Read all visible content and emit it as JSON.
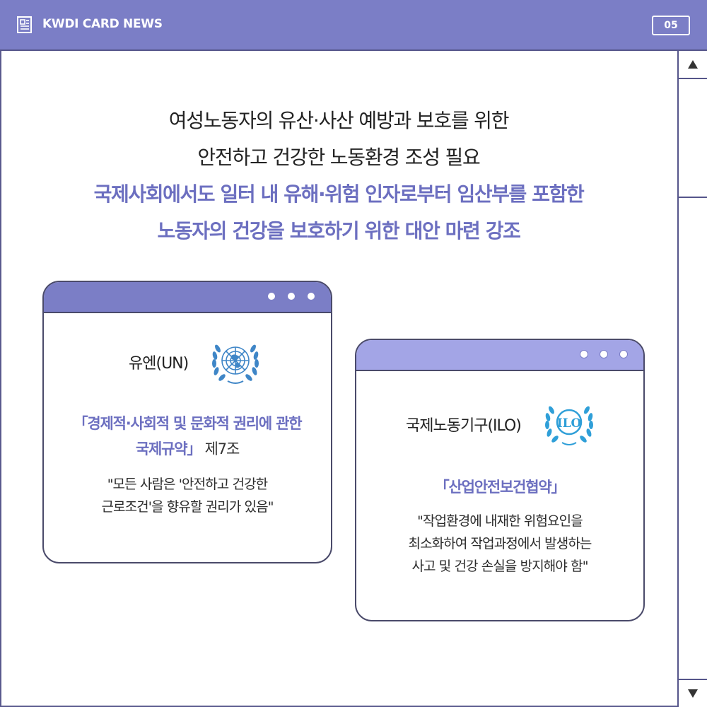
{
  "header": {
    "title": "KWDI CARD NEWS",
    "page_number": "05",
    "icon": "newspaper-icon"
  },
  "headline": {
    "line1": "여성노동자의 유산·사산 예방과 보호를 위한",
    "line2": "안전하고 건강한 노동환경 조성 필요",
    "line3": "국제사회에서도 일터 내 유해·위험 인자로부터 임산부를 포함한",
    "line4": "노동자의 건강을 보호하기 위한 대안 마련 강조"
  },
  "cards": {
    "un": {
      "org_name": "유엔(UN)",
      "logo": "un-emblem-icon",
      "treaty_line1": "「경제적·사회적 및 문화적 권리에 관한",
      "treaty_line2": "국제규약」",
      "treaty_suffix": " 제7조",
      "quote_line1": "\"모든 사람은 '안전하고 건강한",
      "quote_line2": "근로조건'을 향유할 권리가 있음\""
    },
    "ilo": {
      "org_name": "국제노동기구(ILO)",
      "logo": "ilo-emblem-icon",
      "treaty": "「산업안전보건협약」",
      "quote_line1": "\"작업환경에 내재한 위험요인을",
      "quote_line2": "최소화하여 작업과정에서 발생하는",
      "quote_line3": "사고 및 건강 손실을 방지해야 함\""
    }
  },
  "colors": {
    "header": "#7b7ec6",
    "accent": "#6c6fc0",
    "un_blue": "#3f86c7",
    "ilo_blue": "#2f9fd8",
    "ilo_bar": "#a3a5e6"
  }
}
